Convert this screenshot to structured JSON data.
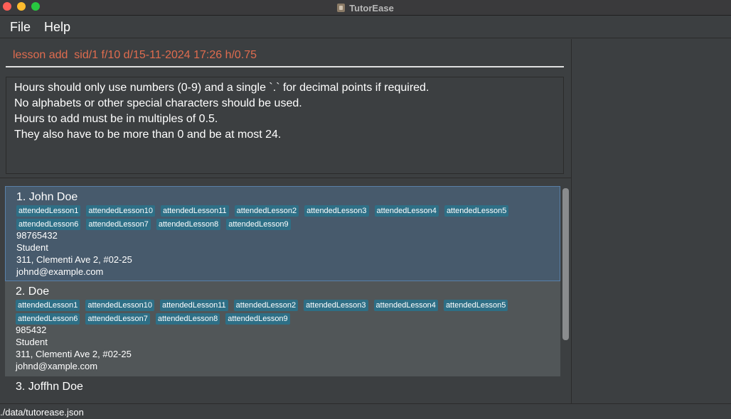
{
  "window": {
    "title": "TutorEase"
  },
  "menu": {
    "file": "File",
    "help": "Help"
  },
  "command": {
    "value": "lesson add  sid/1 f/10 d/15-11-2024 17:26 h/0.75"
  },
  "result": {
    "lines": [
      "Hours should only use numbers (0-9) and a single `.` for decimal points if required.",
      "No alphabets or other special characters should be used.",
      "Hours to add must be in multiples of 0.5.",
      "They also have to be more than 0 and be at most 24."
    ]
  },
  "persons": [
    {
      "name": "1. John Doe",
      "tags": [
        "attendedLesson1",
        "attendedLesson10",
        "attendedLesson11",
        "attendedLesson2",
        "attendedLesson3",
        "attendedLesson4",
        "attendedLesson5",
        "attendedLesson6",
        "attendedLesson7",
        "attendedLesson8",
        "attendedLesson9"
      ],
      "phone": "98765432",
      "role": "Student",
      "address": "311, Clementi Ave 2, #02-25",
      "email": "johnd@example.com"
    },
    {
      "name": "2. Doe",
      "tags": [
        "attendedLesson1",
        "attendedLesson10",
        "attendedLesson11",
        "attendedLesson2",
        "attendedLesson3",
        "attendedLesson4",
        "attendedLesson5",
        "attendedLesson6",
        "attendedLesson7",
        "attendedLesson8",
        "attendedLesson9"
      ],
      "phone": "985432",
      "role": "Student",
      "address": "311, Clementi Ave 2, #02-25",
      "email": "johnd@xample.com"
    },
    {
      "name": "3. Joffhn Doe"
    }
  ],
  "status": {
    "path": "./data/tutorease.json"
  }
}
